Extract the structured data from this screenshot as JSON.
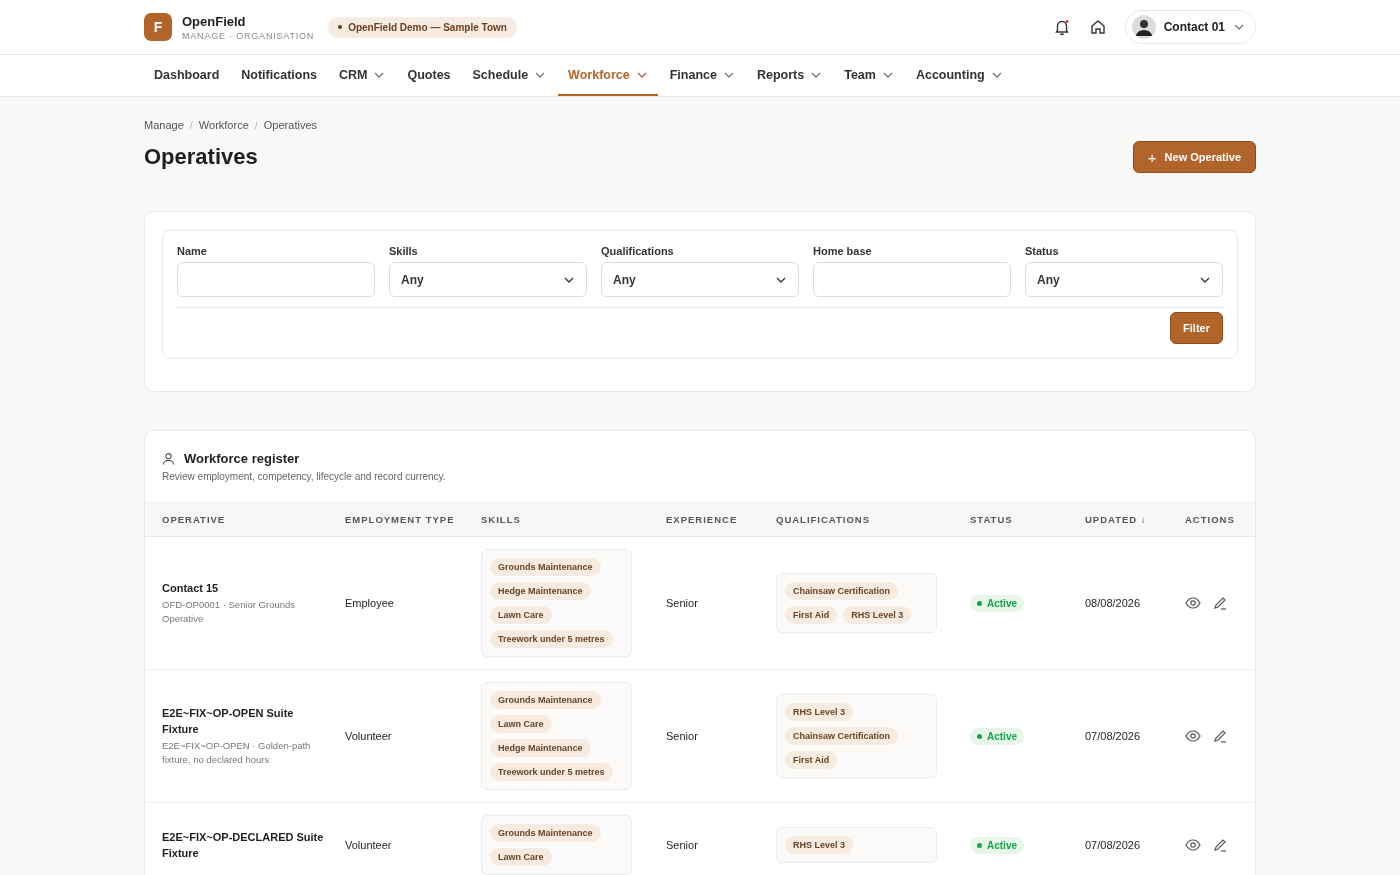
{
  "brand": {
    "logo_letter": "F",
    "name": "OpenField",
    "subtitle": "MANAGE · ORGANISATION",
    "org_badge": "OpenField Demo — Sample Town"
  },
  "header": {
    "notifications_unread": true,
    "user_name": "Contact 01"
  },
  "nav": [
    {
      "label": "Dashboard",
      "dropdown": false,
      "selected": false
    },
    {
      "label": "Notifications",
      "dropdown": false,
      "selected": false
    },
    {
      "label": "CRM",
      "dropdown": true,
      "selected": false
    },
    {
      "label": "Quotes",
      "dropdown": false,
      "selected": false
    },
    {
      "label": "Schedule",
      "dropdown": true,
      "selected": false
    },
    {
      "label": "Workforce",
      "dropdown": true,
      "selected": true
    },
    {
      "label": "Finance",
      "dropdown": true,
      "selected": false
    },
    {
      "label": "Reports",
      "dropdown": true,
      "selected": false
    },
    {
      "label": "Team",
      "dropdown": true,
      "selected": false
    },
    {
      "label": "Accounting",
      "dropdown": true,
      "selected": false
    }
  ],
  "breadcrumb": {
    "separator": "/",
    "items": [
      "Manage",
      "Workforce",
      "Operatives"
    ]
  },
  "page_title": "Operatives",
  "new_button": {
    "icon": "+",
    "label": "New Operative"
  },
  "filters": [
    {
      "label": "Name",
      "kind": "text"
    },
    {
      "label": "Skills",
      "kind": "select",
      "value": "Any"
    },
    {
      "label": "Qualifications",
      "kind": "select",
      "value": "Any"
    },
    {
      "label": "Home base",
      "kind": "text"
    },
    {
      "label": "Status",
      "kind": "select",
      "value": "Any"
    }
  ],
  "filter_button": "Filter",
  "register": {
    "title": "Workforce register",
    "description": "Review employment, competency, lifecycle and record currency.",
    "columns": [
      "OPERATIVE",
      "EMPLOYMENT TYPE",
      "SKILLS",
      "EXPERIENCE",
      "QUALIFICATIONS",
      "STATUS",
      "UPDATED ↓",
      "ACTIONS"
    ],
    "rows": [
      {
        "name": "Contact 15",
        "detail": "OFD-OP0001 · Senior Grounds Operative",
        "employment": "Employee",
        "skills": [
          "Grounds Maintenance",
          "Hedge Maintenance",
          "Lawn Care",
          "Treework under 5 metres"
        ],
        "experience": "Senior",
        "qualifications": [
          "Chainsaw Certification",
          "First Aid",
          "RHS Level 3"
        ],
        "status": "Active",
        "color": "#16a34a",
        "updated": "08/08/2026"
      },
      {
        "name": "E2E~FIX~OP-OPEN Suite Fixture",
        "detail": "E2E~FIX~OP-OPEN · Golden-path fixture, no declared hours",
        "employment": "Volunteer",
        "skills": [
          "Grounds Maintenance",
          "Lawn Care",
          "Hedge Maintenance",
          "Treework under 5 metres"
        ],
        "experience": "Senior",
        "qualifications": [
          "RHS Level 3",
          "Chainsaw Certification",
          "First Aid"
        ],
        "status": "Active",
        "color": "#16a34a",
        "updated": "07/08/2026"
      },
      {
        "name": "E2E~FIX~OP-DECLARED Suite Fixture",
        "employment": "Volunteer",
        "skills": [
          "Grounds Maintenance",
          "Lawn Care"
        ],
        "experience": "Senior",
        "qualifications": [
          "RHS Level 3"
        ],
        "status": "Active",
        "color": "#16a34a",
        "updated": "07/08/2026"
      }
    ]
  }
}
